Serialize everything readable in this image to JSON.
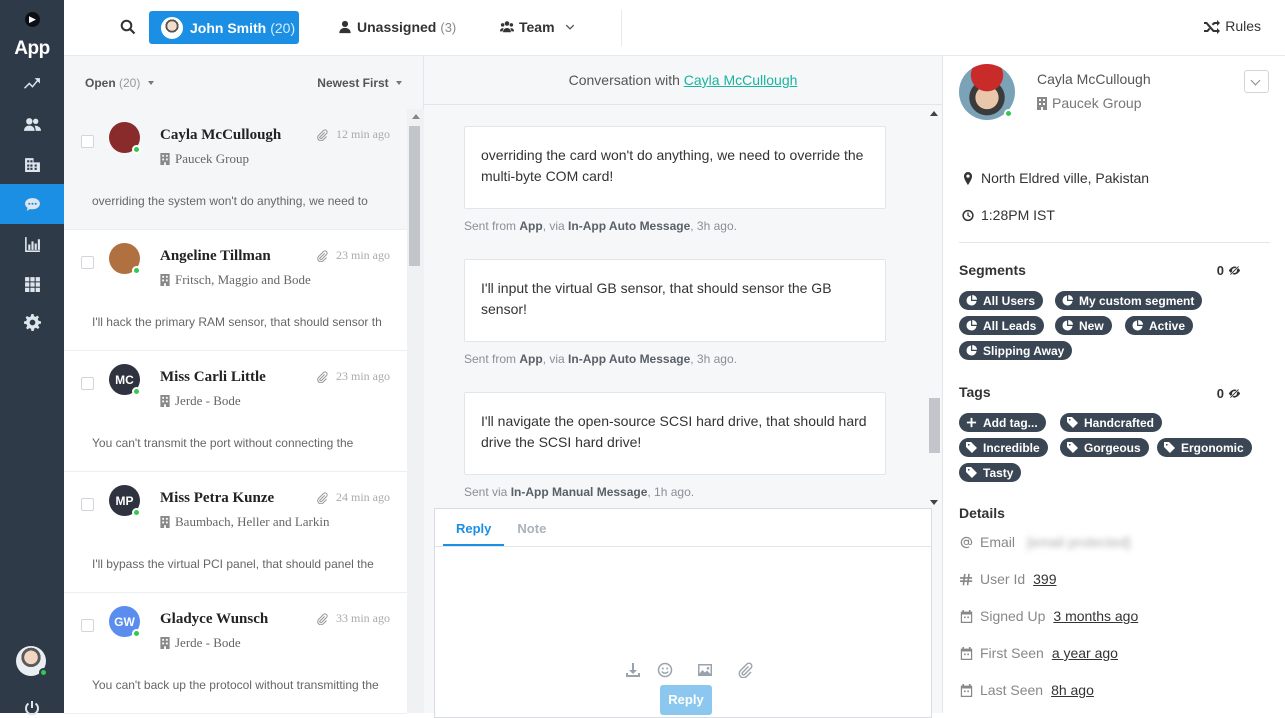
{
  "nav": {
    "app_label": "App",
    "items": [
      "trend-icon",
      "people-icon",
      "building-icon",
      "chat-icon",
      "chart-icon",
      "apps-icon",
      "gear-icon"
    ],
    "active": "chat-icon"
  },
  "topbar": {
    "me_tab": {
      "name": "John Smith",
      "count": "(20)"
    },
    "unassigned": {
      "label": "Unassigned",
      "count": "(3)"
    },
    "team": {
      "label": "Team"
    },
    "rules": "Rules"
  },
  "list": {
    "filter": "Open",
    "filter_count": "(20)",
    "sort": "Newest First",
    "conversations": [
      {
        "name": "Cayla McCullough",
        "company": "Paucek Group",
        "time": "12 min ago",
        "preview": "overriding the system won't do anything, we need to",
        "avatar": "",
        "color": "#8a2b2b"
      },
      {
        "name": "Angeline Tillman",
        "company": "Fritsch, Maggio and Bode",
        "time": "23 min ago",
        "preview": "I'll hack the primary RAM sensor, that should sensor the",
        "avatar": "",
        "color": "#b07040"
      },
      {
        "name": "Miss Carli Little",
        "company": "Jerde - Bode",
        "time": "23 min ago",
        "preview": "You can't transmit the port without connecting the",
        "avatar": "MC",
        "color": "#2f3340"
      },
      {
        "name": "Miss Petra Kunze",
        "company": "Baumbach, Heller and Larkin",
        "time": "24 min ago",
        "preview": "I'll bypass the virtual PCI panel, that should panel the",
        "avatar": "MP",
        "color": "#2f3340"
      },
      {
        "name": "Gladyce Wunsch",
        "company": "Jerde - Bode",
        "time": "33 min ago",
        "preview": "You can't back up the protocol without transmitting the",
        "avatar": "GW",
        "color": "#5b8def"
      }
    ]
  },
  "conversation": {
    "title_prefix": "Conversation with",
    "title_name": "Cayla McCullough",
    "messages": [
      {
        "text": "overriding the card won't do anything, we need to override the multi-byte COM card!",
        "meta_a": "Sent from ",
        "meta_b": "App",
        "meta_c": ", via ",
        "meta_d": "In-App Auto Message",
        "meta_e": ", 3h ago."
      },
      {
        "text": "I'll input the virtual GB sensor, that should sensor the GB sensor!",
        "meta_a": "Sent from ",
        "meta_b": "App",
        "meta_c": ", via ",
        "meta_d": "In-App Auto Message",
        "meta_e": ", 3h ago."
      },
      {
        "text": "I'll navigate the open-source SCSI hard drive, that should hard drive the SCSI hard drive!",
        "meta_a": "Sent via ",
        "meta_b": "In-App Manual Message",
        "meta_c": ", 1h ago.",
        "meta_d": "",
        "meta_e": ""
      }
    ],
    "composer": {
      "tab_reply": "Reply",
      "tab_note": "Note",
      "send": "Reply"
    }
  },
  "profile": {
    "name": "Cayla McCullough",
    "company": "Paucek Group",
    "location": "North Eldred ville, Pakistan",
    "local_time": "1:28PM IST",
    "segments_title": "Segments",
    "segments_count": "0",
    "segments": [
      "All Users",
      "My custom segment",
      "All Leads",
      "New",
      "Active",
      "Slipping Away"
    ],
    "tags_title": "Tags",
    "tags_count": "0",
    "add_tag": "Add tag...",
    "tags": [
      "Handcrafted",
      "Incredible",
      "Gorgeous",
      "Ergonomic",
      "Tasty"
    ],
    "details_title": "Details",
    "details": {
      "email_label": "Email",
      "email_value": "[email protected]",
      "user_id_label": "User Id",
      "user_id_value": "399",
      "signed_up_label": "Signed Up",
      "signed_up_value": "3 months ago",
      "first_seen_label": "First Seen",
      "first_seen_value": "a year ago",
      "last_seen_label": "Last Seen",
      "last_seen_value": "8h ago"
    }
  }
}
